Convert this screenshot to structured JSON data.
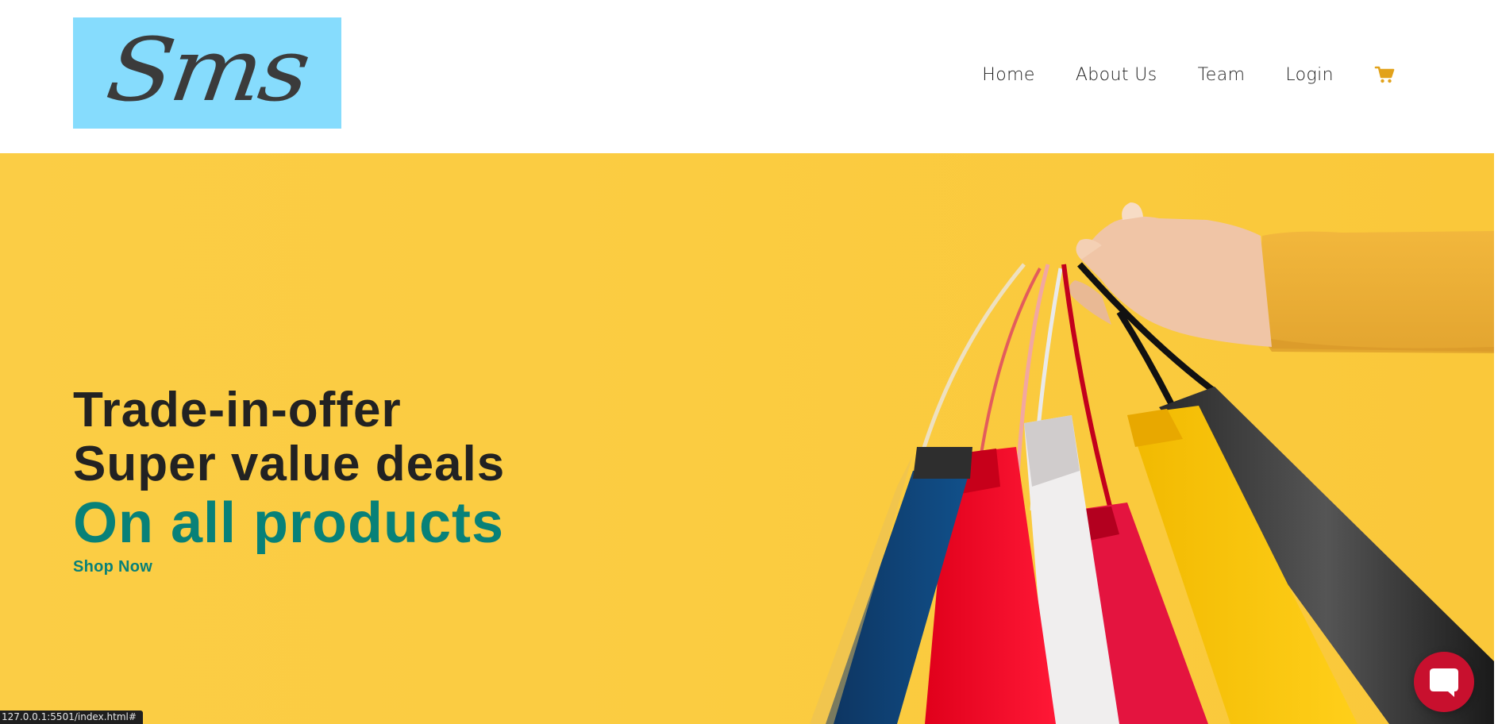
{
  "header": {
    "logo_text": "Sms",
    "nav": [
      {
        "label": "Home"
      },
      {
        "label": "About Us"
      },
      {
        "label": "Team"
      },
      {
        "label": "Login"
      }
    ],
    "cart_icon": "shopping-cart-icon"
  },
  "hero": {
    "line1": "Trade-in-offer",
    "line2": "Super value deals",
    "line3": "On all products",
    "cta": "Shop Now",
    "image": "hand-holding-shopping-bags"
  },
  "chat": {
    "icon": "chat-bubble-icon"
  },
  "status_bar": {
    "url": "127.0.0.1:5501/index.html#"
  },
  "colors": {
    "logo_bg": "#86dcfd",
    "hero_bg": "#fbcb3f",
    "accent_teal": "#088178",
    "cart_orange": "#e2a21b",
    "chat_red": "#c8102e"
  }
}
